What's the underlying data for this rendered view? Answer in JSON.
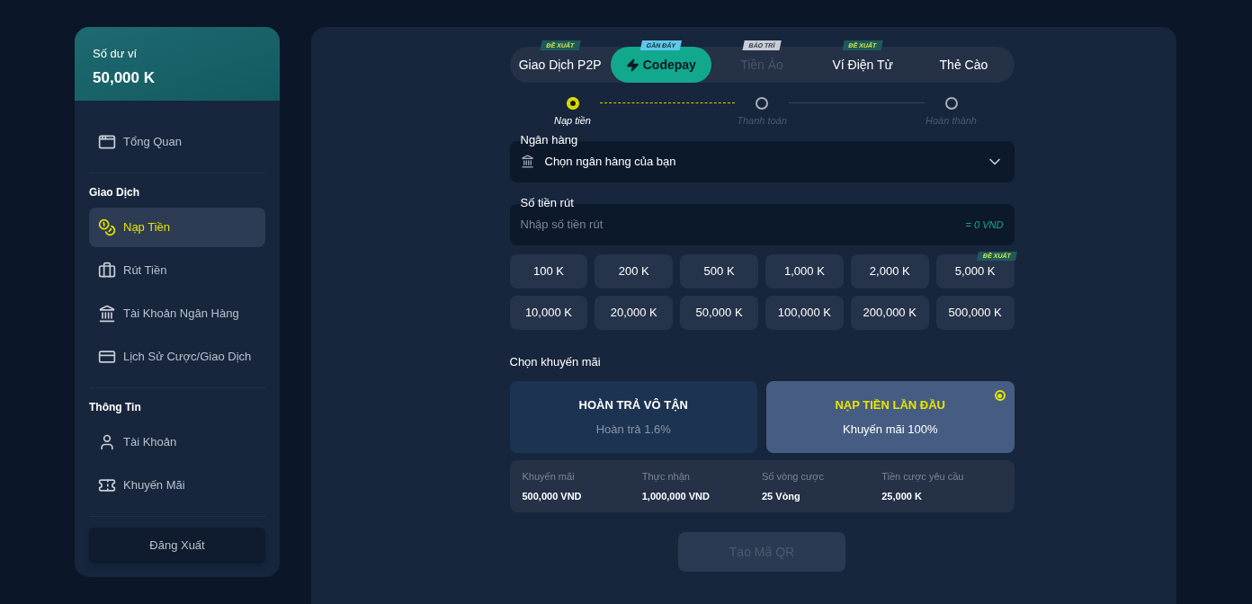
{
  "wallet": {
    "label": "Số dư ví",
    "balance": "50,000 K"
  },
  "sidebar": {
    "sections": [
      {
        "items": [
          {
            "label": "Tổng Quan",
            "selected": false
          }
        ]
      },
      {
        "title": "Giao Dịch",
        "items": [
          {
            "label": "Nạp Tiền",
            "selected": true
          },
          {
            "label": "Rút Tiền",
            "selected": false
          },
          {
            "label": "Tài Khoản Ngân Hàng",
            "selected": false
          },
          {
            "label": "Lịch Sử Cược/Giao Dịch",
            "selected": false
          }
        ]
      },
      {
        "title": "Thông Tin",
        "items": [
          {
            "label": "Tài Khoản",
            "selected": false
          },
          {
            "label": "Khuyến Mãi",
            "selected": false
          }
        ]
      }
    ],
    "logout": "Đăng Xuất"
  },
  "tabs": [
    {
      "label": "Giao Dịch P2P",
      "selected": false,
      "disabled": false,
      "badge": {
        "text": "ĐỀ XUẤT",
        "kind": "recommended"
      }
    },
    {
      "label": "Codepay",
      "selected": true,
      "disabled": false,
      "badge": {
        "text": "GẦN ĐÂY",
        "kind": "recent"
      }
    },
    {
      "label": "Tiền Ảo",
      "selected": false,
      "disabled": true,
      "badge": {
        "text": "BẢO TRÌ",
        "kind": "maintenance"
      }
    },
    {
      "label": "Ví Điện Tử",
      "selected": false,
      "disabled": false,
      "badge": {
        "text": "ĐỀ XUẤT",
        "kind": "recommended"
      }
    },
    {
      "label": "Thẻ Cào",
      "selected": false,
      "disabled": false
    }
  ],
  "steps": [
    {
      "label": "Nạp tiền",
      "selected": true
    },
    {
      "label": "Thanh toán",
      "selected": false
    },
    {
      "label": "Hoàn thành",
      "selected": false
    }
  ],
  "bank_field": {
    "label": "Ngân hàng",
    "placeholder": "Chọn ngân hàng của bạn"
  },
  "amount_field": {
    "label": "Số tiền rút",
    "placeholder": "Nhập số tiền rút",
    "conversion": "= 0 VND"
  },
  "amounts": [
    {
      "label": "100 K"
    },
    {
      "label": "200 K"
    },
    {
      "label": "500 K"
    },
    {
      "label": "1,000 K"
    },
    {
      "label": "2,000 K"
    },
    {
      "label": "5,000 K",
      "badge": "ĐỀ XUẤT"
    },
    {
      "label": "10,000 K"
    },
    {
      "label": "20,000 K"
    },
    {
      "label": "50,000 K"
    },
    {
      "label": "100,000 K"
    },
    {
      "label": "200,000 K"
    },
    {
      "label": "500,000 K"
    }
  ],
  "promo": {
    "title": "Chọn khuyến mãi",
    "options": [
      {
        "name": "HOÀN TRẢ VÔ TẬN",
        "detail": "Hoàn trả 1.6%",
        "selected": false
      },
      {
        "name": "NẠP TIỀN LẦN ĐẦU",
        "detail": "Khuyến mãi 100%",
        "selected": true
      }
    ],
    "details": [
      {
        "label": "Khuyến mãi",
        "value": "500,000 VND"
      },
      {
        "label": "Thực nhận",
        "value": "1,000,000 VND"
      },
      {
        "label": "Số vòng cược",
        "value": "25 Vòng"
      },
      {
        "label": "Tiền cược yêu cầu",
        "value": "25,000 K"
      }
    ]
  },
  "submit": {
    "label": "Tạo Mã QR",
    "disabled": true
  }
}
